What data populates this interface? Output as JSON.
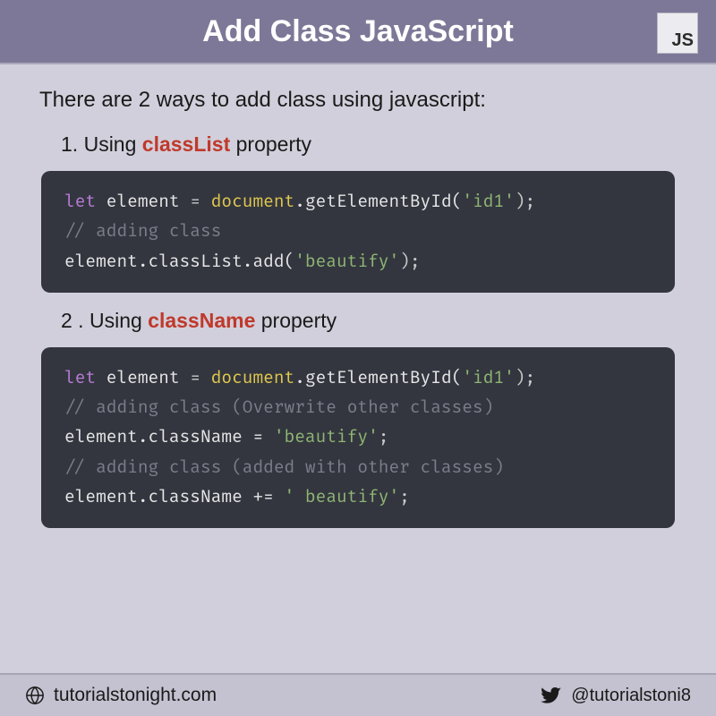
{
  "header": {
    "title": "Add Class JavaScript",
    "badge": "JS"
  },
  "intro": "There are 2 ways to add class using javascript:",
  "methods": [
    {
      "num": "1.",
      "prefix": "Using ",
      "keyword": "classList",
      "suffix": " property"
    },
    {
      "num": "2 .",
      "prefix": "Using ",
      "keyword": "className",
      "suffix": " property"
    }
  ],
  "code1": {
    "l1_kw": "let",
    "l1_var": " element ",
    "l1_eq": "= ",
    "l1_obj": "document",
    "l1_rest": ".getElementById(",
    "l1_str": "'id1'",
    "l1_end": ");",
    "l2": "// adding class",
    "l3_a": "element.classList.add(",
    "l3_str": "'beautify'",
    "l3_end": ");"
  },
  "code2": {
    "l1_kw": "let",
    "l1_var": " element ",
    "l1_eq": "= ",
    "l1_obj": "document",
    "l1_rest": ".getElementById(",
    "l1_str": "'id1'",
    "l1_end": ");",
    "l2": "// adding class (Overwrite other classes)",
    "l3_a": "element.className = ",
    "l3_str": "'beautify'",
    "l3_end": ";",
    "l4": "// adding class (added with other classes)",
    "l5_a": "element.className += ",
    "l5_str": "' beautify'",
    "l5_end": ";"
  },
  "footer": {
    "site": "tutorialstonight.com",
    "handle": "@tutorialstoni8"
  }
}
